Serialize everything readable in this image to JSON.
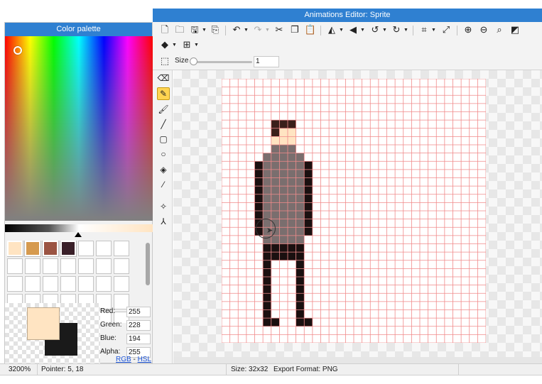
{
  "window": {
    "title": "Animations Editor: Sprite"
  },
  "palette": {
    "header": "Color palette",
    "swatches": [
      {
        "color": "#ffe4c2"
      },
      {
        "color": "#d69a4e"
      },
      {
        "color": "#9b5443"
      },
      {
        "color": "#3a2029"
      }
    ],
    "empty_swatch_count": 31,
    "primary_color": "#ffe4c2",
    "secondary_color": "#1a1a1a",
    "rgba": {
      "red_label": "Red:",
      "red": "255",
      "green_label": "Green:",
      "green": "228",
      "blue_label": "Blue:",
      "blue": "194",
      "alpha_label": "Alpha:",
      "alpha": "255"
    },
    "mode_rgb": "RGB",
    "mode_separator": "-",
    "mode_hsl": "HSL"
  },
  "toolbar": {
    "size_label": "Size",
    "size_value": "1",
    "size_fraction": 0.0
  },
  "tools": [
    {
      "name": "eraser-tool",
      "icon": "eraser-icon",
      "glyph": "⌫"
    },
    {
      "name": "pencil-tool",
      "icon": "pencil-icon",
      "glyph": "✎",
      "active": true
    },
    {
      "name": "brush-tool",
      "icon": "brush-icon",
      "glyph": "🖌"
    },
    {
      "name": "line-tool",
      "icon": "line-icon",
      "glyph": "╱"
    },
    {
      "name": "rectangle-tool",
      "icon": "rectangle-icon",
      "glyph": "▢"
    },
    {
      "name": "ellipse-tool",
      "icon": "ellipse-icon",
      "glyph": "○"
    },
    {
      "name": "fill-tool",
      "icon": "paint-bucket-icon",
      "glyph": "◈"
    },
    {
      "name": "eyedropper-tool",
      "icon": "eyedropper-icon",
      "glyph": "⁄"
    },
    {
      "name": "selection-tool",
      "icon": "magic-wand-icon",
      "glyph": "✧"
    },
    {
      "name": "transform-tool",
      "icon": "bone-icon",
      "glyph": "⅄"
    }
  ],
  "sprite": {
    "width": 32,
    "height": 32,
    "palette": {
      "K": "#1a1010",
      "H": "#3a1f1a",
      "S": "#ffe4c2",
      "G": "#7a6e6e"
    },
    "rows": [
      "................................",
      "................................",
      "................................",
      "................................",
      "................................",
      "......HHH.......................",
      "......HSS.......................",
      "......SSS.......................",
      "......GGG.......................",
      ".....GGGGG......................",
      "....KGGGGGK.....................",
      "....KGGGGGK.....................",
      "....KGGGGGK.....................",
      "....KGGGGGK.....................",
      "....KGGGGGK.....................",
      "....KGGGGGK.....................",
      "....KGGGGGK.....................",
      "....KGGGGGK.....................",
      "....KGGGGGK.....................",
      ".....GGGGG......................",
      ".....KKKKK......................",
      ".....KKKKK......................",
      ".....K...K......................",
      ".....K...K......................",
      ".....K...K......................",
      ".....K...K......................",
      ".....K...K......................",
      ".....K...K......................",
      ".....K...K......................",
      ".....KK..KK.....................",
      "................................",
      "................................"
    ]
  },
  "status": {
    "zoom": "3200%",
    "pointer": "Pointer: 5, 18",
    "size": "Size: 32x32",
    "format": "Export Format: PNG"
  }
}
